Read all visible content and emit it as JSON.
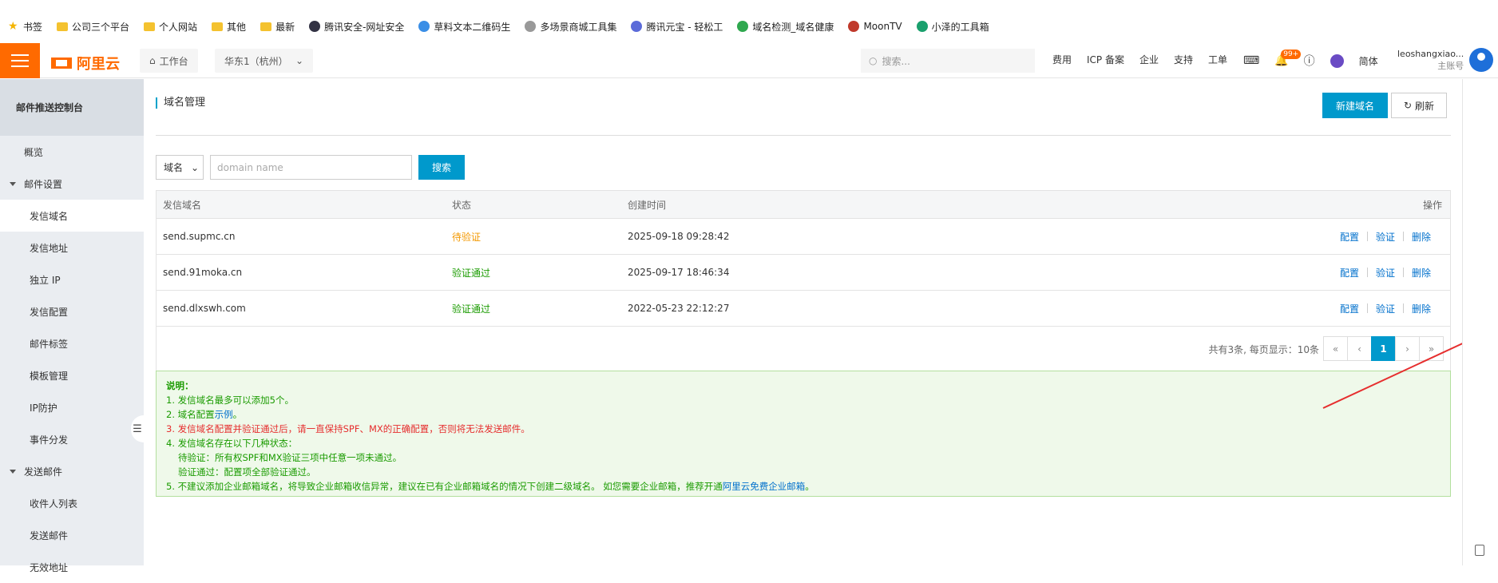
{
  "bookmarks": [
    {
      "label": "书签",
      "icon": "star-icon"
    },
    {
      "label": "公司三个平台",
      "icon": "folder-icon"
    },
    {
      "label": "个人网站",
      "icon": "folder-icon"
    },
    {
      "label": "其他",
      "icon": "folder-icon"
    },
    {
      "label": "最新",
      "icon": "folder-icon"
    },
    {
      "label": "腾讯安全-网址安全",
      "icon": "tencent-security-icon"
    },
    {
      "label": "草料文本二维码生",
      "icon": "qrcode-icon"
    },
    {
      "label": "多场景商城工具集",
      "icon": "shop-icon"
    },
    {
      "label": "腾讯元宝 - 轻松工",
      "icon": "yuanbao-icon"
    },
    {
      "label": "域名检测_域名健康",
      "icon": "domain-check-icon"
    },
    {
      "label": "MoonTV",
      "icon": "moontv-icon"
    },
    {
      "label": "小泽的工具箱",
      "icon": "toolbox-icon"
    }
  ],
  "nav": {
    "logo": "阿里云",
    "workbench": "工作台",
    "region": "华东1（杭州）",
    "search_placeholder": "搜索...",
    "links": [
      "费用",
      "ICP 备案",
      "企业",
      "支持",
      "工单"
    ],
    "notification_badge": "99+",
    "lang": "简体",
    "username": "leoshangxiao...",
    "account_type": "主账号"
  },
  "sidebar": {
    "title": "邮件推送控制台",
    "items": [
      {
        "label": "概览",
        "kind": "item"
      },
      {
        "label": "邮件设置",
        "kind": "group"
      },
      {
        "label": "发信域名",
        "kind": "sub",
        "active": true
      },
      {
        "label": "发信地址",
        "kind": "sub"
      },
      {
        "label": "独立 IP",
        "kind": "sub"
      },
      {
        "label": "发信配置",
        "kind": "sub"
      },
      {
        "label": "邮件标签",
        "kind": "sub"
      },
      {
        "label": "模板管理",
        "kind": "sub"
      },
      {
        "label": "IP防护",
        "kind": "sub"
      },
      {
        "label": "事件分发",
        "kind": "sub"
      },
      {
        "label": "发送邮件",
        "kind": "group"
      },
      {
        "label": "收件人列表",
        "kind": "sub"
      },
      {
        "label": "发送邮件",
        "kind": "sub"
      },
      {
        "label": "无效地址",
        "kind": "sub"
      }
    ]
  },
  "main": {
    "title": "域名管理",
    "new_button": "新建域名",
    "refresh_button": "刷新",
    "filter_select": "域名",
    "search_placeholder": "domain name",
    "search_button": "搜索",
    "columns": [
      "发信域名",
      "状态",
      "创建时间",
      "操作"
    ],
    "rows": [
      {
        "domain": "send.supmc.cn",
        "status": "待验证",
        "status_type": "pending",
        "created": "2025-09-18 09:28:42"
      },
      {
        "domain": "send.91moka.cn",
        "status": "验证通过",
        "status_type": "ok",
        "created": "2025-09-17 18:46:34"
      },
      {
        "domain": "send.dlxswh.com",
        "status": "验证通过",
        "status_type": "ok",
        "created": "2022-05-23 22:12:27"
      }
    ],
    "actions": [
      "配置",
      "验证",
      "删除"
    ],
    "pager_info": "共有3条, 每页显示：10条",
    "pager": [
      "«",
      "‹",
      "1",
      "›",
      "»"
    ],
    "current_page": "1"
  },
  "notice": {
    "heading": "说明：",
    "l1": "1. 发信域名最多可以添加5个。",
    "l2_pre": "2. 域名配置",
    "l2_link": "示例",
    "l2_post": "。",
    "l3": "3. 发信域名配置并验证通过后，请一直保持SPF、MX的正确配置，否则将无法发送邮件。",
    "l4": "4. 发信域名存在以下几种状态：",
    "l4a": "待验证：所有权SPF和MX验证三项中任意一项未通过。",
    "l4b": "验证通过：配置项全部验证通过。",
    "l5_pre": "5. 不建议添加企业邮箱域名，将导致企业邮箱收信异常，建议在已有企业邮箱域名的情况下创建二级域名。 如您需要企业邮箱，推荐开通",
    "l5_link": "阿里云免费企业邮箱",
    "l5_post": "。"
  },
  "colors": {
    "brand": "#ff6a00",
    "primary": "#0099cc",
    "pending": "#f39800",
    "ok": "#1a9b00",
    "link": "#0070cc",
    "annotation_arrow": "#e62e2e"
  }
}
